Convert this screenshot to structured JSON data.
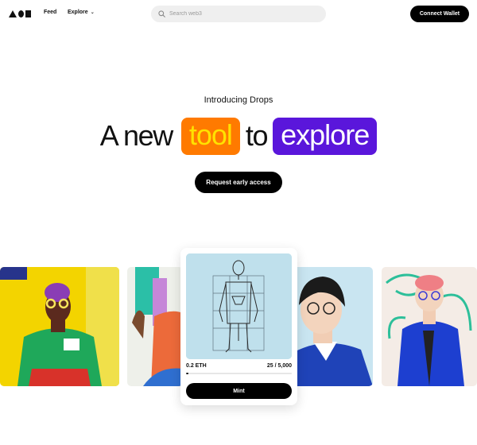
{
  "nav": {
    "feed_label": "Feed",
    "explore_label": "Explore",
    "search_placeholder": "Search web3",
    "connect_label": "Connect Wallet"
  },
  "hero": {
    "kicker": "Introducing Drops",
    "headline_a": "A new",
    "headline_tool": "tool",
    "headline_to": "to",
    "headline_explore": "explore",
    "cta_label": "Request early access",
    "colors": {
      "tool_bg": "#ff7a00",
      "tool_text": "#ffe200",
      "explore_bg": "#5a16db"
    }
  },
  "drop": {
    "price": "0.2 ETH",
    "supply": "25 / 5,000",
    "minted_fraction": 0.005,
    "mint_label": "Mint"
  },
  "icons": {
    "search": "search-icon",
    "chevron": "chevron-down-icon"
  }
}
